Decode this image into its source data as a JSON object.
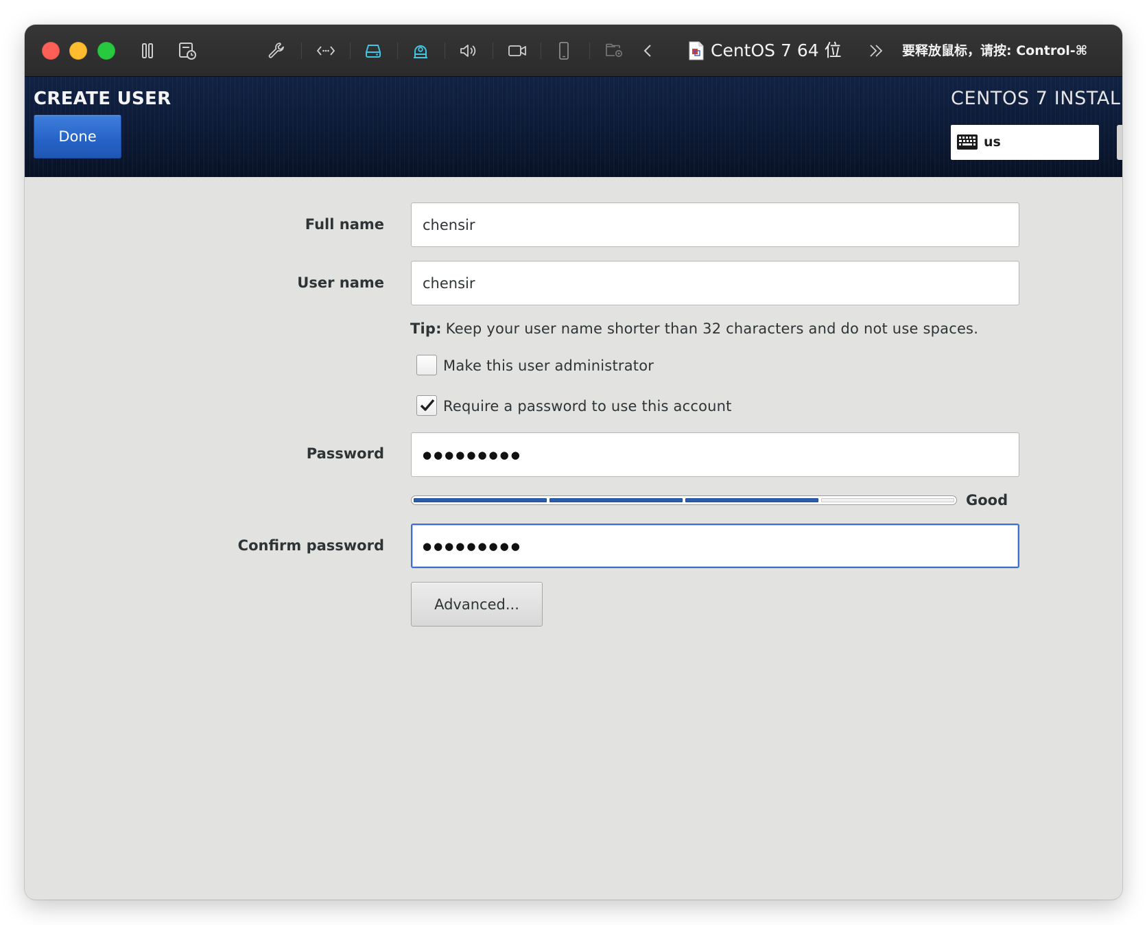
{
  "titlebar": {
    "title": "CentOS 7 64 位",
    "hint": "要释放鼠标，请按: Control-⌘",
    "icons": [
      "pause-icon",
      "snapshot-icon",
      "wrench-icon",
      "code-icon",
      "hard-drive-icon",
      "webcam-icon",
      "speaker-icon",
      "video-camera-icon",
      "phone-icon",
      "shared-folder-icon",
      "chevron-left-icon",
      "double-chevron-right-icon"
    ]
  },
  "header": {
    "title": "CREATE USER",
    "done_label": "Done",
    "product": "CENTOS 7 INSTAL",
    "keyboard_layout": "us"
  },
  "form": {
    "full_name": {
      "label": "Full name",
      "value": "chensir"
    },
    "user_name": {
      "label": "User name",
      "value": "chensir"
    },
    "tip": {
      "prefix": "Tip:",
      "text": "Keep your user name shorter than 32 characters and do not use spaces."
    },
    "admin": {
      "label": "Make this user administrator",
      "checked": false
    },
    "require_password": {
      "label": "Require a password to use this account",
      "checked": true
    },
    "password": {
      "label": "Password",
      "value": "●●●●●●●●●"
    },
    "strength": {
      "label": "Good",
      "filled_segments": 3,
      "total_segments": 4
    },
    "confirm_password": {
      "label": "Confirm password",
      "value": "●●●●●●●●●"
    },
    "advanced_label": "Advanced..."
  },
  "colors": {
    "accent": "#2a5db0",
    "focus": "#3a6fd3",
    "header_bg": "#0c1a35",
    "content_bg": "#e2e2e1",
    "active_icon": "#41c7e6"
  }
}
